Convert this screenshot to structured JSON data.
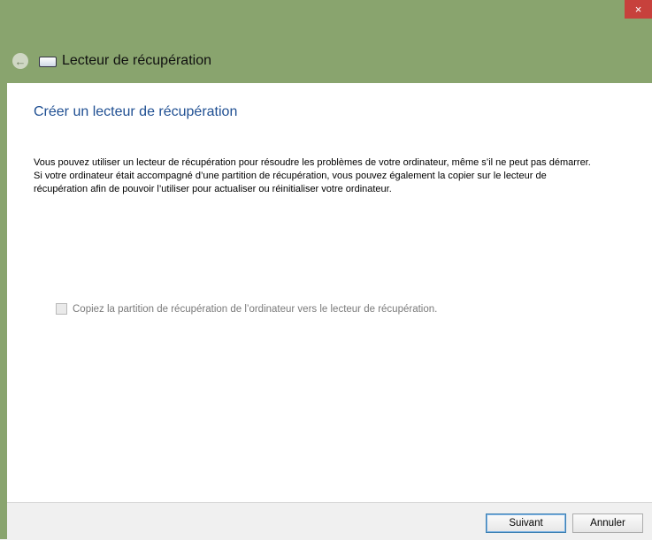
{
  "window": {
    "title": "Lecteur de récupération",
    "close_glyph": "×"
  },
  "nav": {
    "back_icon": "back-arrow-icon",
    "drive_icon": "drive-icon"
  },
  "content": {
    "heading": "Créer un lecteur de récupération",
    "description": "Vous pouvez utiliser un lecteur de récupération pour résoudre les problèmes de votre ordinateur, même s’il ne peut pas démarrer. Si votre ordinateur était accompagné d’une partition de récupération, vous pouvez également la copier sur le lecteur de récupération afin de pouvoir l’utiliser pour actualiser ou réinitialiser votre ordinateur.",
    "checkbox_label": "Copiez la partition de récupération de l’ordinateur vers le lecteur de récupération.",
    "checkbox_checked": false,
    "checkbox_enabled": false
  },
  "footer": {
    "next_label": "Suivant",
    "cancel_label": "Annuler"
  }
}
